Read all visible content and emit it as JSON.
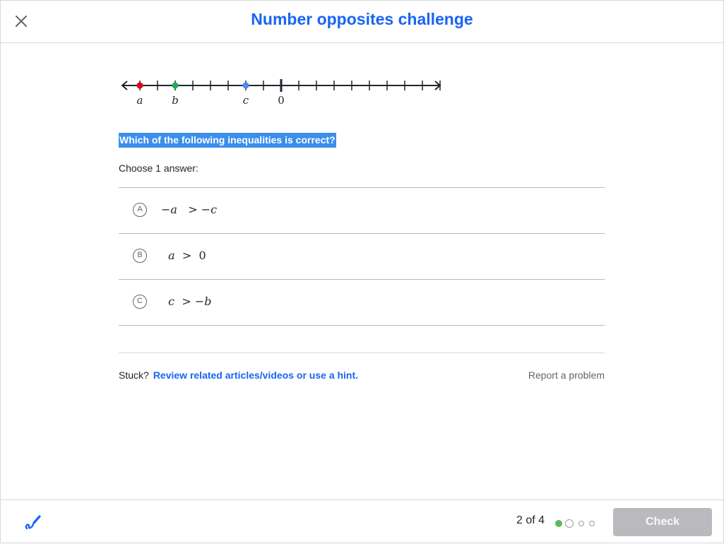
{
  "header": {
    "title": "Number opposites challenge",
    "close_icon": "close-icon"
  },
  "number_line": {
    "labels": [
      "a",
      "b",
      "c",
      "0"
    ],
    "point_colors": {
      "a": "#e0001b",
      "b": "#1fab54",
      "c": "#4f86f7"
    }
  },
  "question": {
    "prompt": "Which of the following inequalities is correct?",
    "instruction": "Choose 1 answer:"
  },
  "choices": [
    {
      "letter": "A",
      "lhs": "−a",
      "op": ">",
      "rhs": "−c"
    },
    {
      "letter": "B",
      "lhs": "a",
      "op": ">",
      "rhs": "0"
    },
    {
      "letter": "C",
      "lhs": "c",
      "op": ">",
      "rhs": "−b"
    }
  ],
  "help": {
    "stuck": "Stuck?",
    "link": "Review related articles/videos or use a hint.",
    "report": "Report a problem"
  },
  "footer": {
    "scratchpad_icon": "scratchpad-pencil-icon",
    "progress": "2 of 4",
    "check_label": "Check"
  },
  "colors": {
    "accent": "#1865f2",
    "highlight": "#3b8eea",
    "progress_done": "#5cb85c",
    "button_disabled": "#bababe"
  }
}
